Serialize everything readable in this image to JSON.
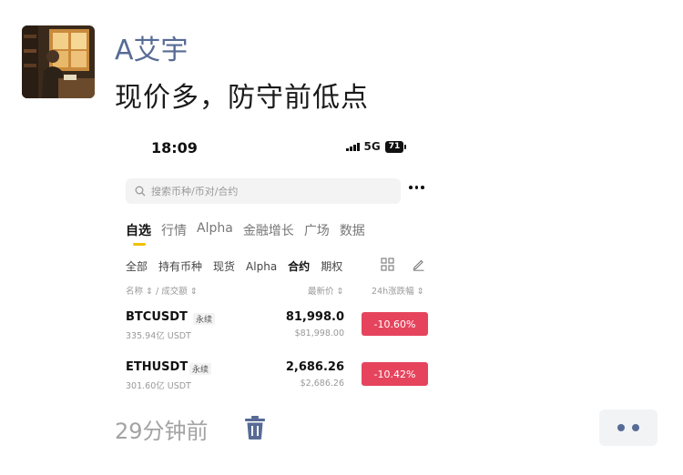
{
  "post": {
    "username": "A艾宇",
    "text": "现价多，防守前低点",
    "time": "29分钟前"
  },
  "screenshot": {
    "status_bar": {
      "time": "18:09",
      "network": "5G",
      "battery": "71"
    },
    "search": {
      "placeholder": "搜索币种/币对/合约"
    },
    "tabs": [
      "自选",
      "行情",
      "Alpha",
      "金融增长",
      "广场",
      "数据"
    ],
    "subtabs": [
      "全部",
      "持有币种",
      "现货",
      "Alpha",
      "合约",
      "期权"
    ],
    "columns": {
      "name": "名称 ⇕ / 成交额 ⇕",
      "price": "最新价 ⇕",
      "change": "24h涨跌幅 ⇕"
    },
    "rows": [
      {
        "symbol": "BTCUSDT",
        "tag": "永续",
        "volume": "335.94亿 USDT",
        "price": "81,998.0",
        "fiat": "$81,998.00",
        "change": "-10.60%"
      },
      {
        "symbol": "ETHUSDT",
        "tag": "永续",
        "volume": "301.60亿 USDT",
        "price": "2,686.26",
        "fiat": "$2,686.26",
        "change": "-10.42%"
      }
    ],
    "colors": {
      "down": "#e6445d",
      "accent": "#f0c000",
      "name_link": "#576b95"
    }
  }
}
